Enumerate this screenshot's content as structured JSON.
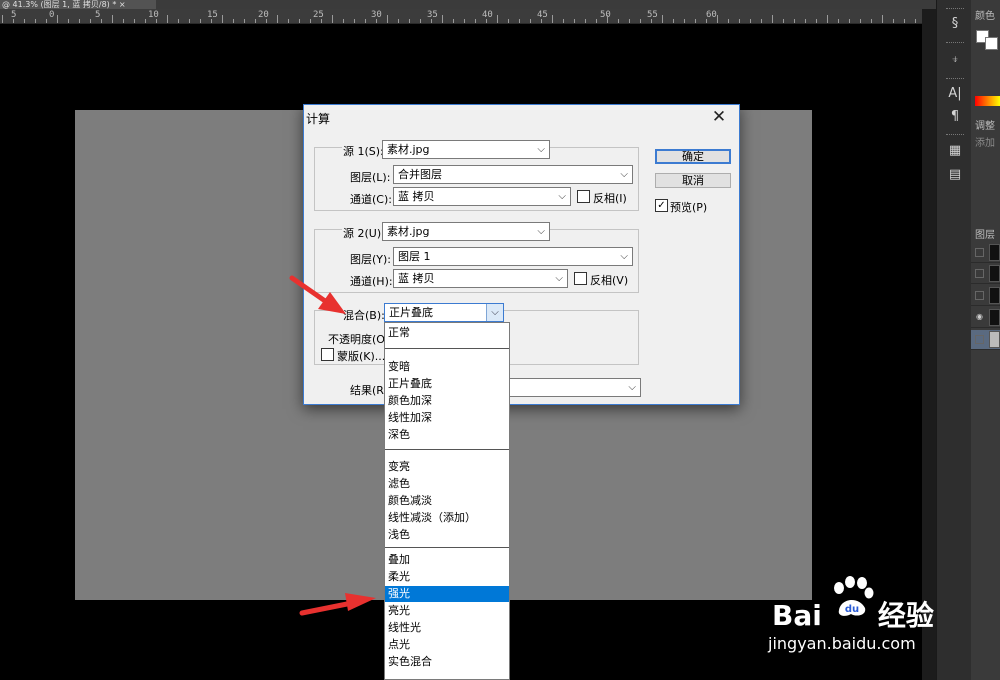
{
  "document": {
    "tab_title": "@ 41.3% (图层 1, 蓝 拷贝/8) *",
    "tab_close": "×"
  },
  "ruler": {
    "numbers": [
      "5",
      "0",
      "5",
      "10",
      "15",
      "20",
      "25",
      "30",
      "35",
      "40",
      "45",
      "50",
      "55",
      "60"
    ]
  },
  "tool_panel": {
    "icons": [
      "history-brush-icon",
      "clone-source-icon",
      "character-icon",
      "paragraph-icon",
      "properties-icon",
      "notes-icon"
    ],
    "glyphs": [
      "§",
      "⍖",
      "A|",
      "¶",
      "▦",
      "▤"
    ]
  },
  "side_panel": {
    "color_tab": "颜色",
    "adjust_tab": "调整",
    "adjust_add": "添加",
    "layers_tab": "图层"
  },
  "dialog": {
    "title": "计算",
    "close": "✕",
    "source1": {
      "label": "源 1(S):",
      "value": "素材.jpg",
      "layer_label": "图层(L):",
      "layer_value": "合并图层",
      "channel_label": "通道(C):",
      "channel_value": "蓝 拷贝",
      "invert_label": "反相(I)",
      "invert_checked": false
    },
    "source2": {
      "label": "源 2(U):",
      "value": "素材.jpg",
      "layer_label": "图层(Y):",
      "layer_value": "图层 1",
      "channel_label": "通道(H):",
      "channel_value": "蓝 拷贝",
      "invert_label": "反相(V)",
      "invert_checked": false
    },
    "blending": {
      "label": "混合(B):",
      "value": "正片叠底",
      "opacity_label": "不透明度(O",
      "mask_label": "蒙版(K)..."
    },
    "result_label": "结果(R",
    "ok_button": "确定",
    "cancel_button": "取消",
    "preview_label": "预览(P)",
    "preview_checked": true
  },
  "dropdown": {
    "groups": [
      [
        "正常"
      ],
      [
        "变暗",
        "正片叠底",
        "颜色加深",
        "线性加深",
        "深色"
      ],
      [
        "变亮",
        "滤色",
        "颜色减淡",
        "线性减淡（添加）",
        "浅色"
      ],
      [
        "叠加",
        "柔光",
        "强光",
        "亮光",
        "线性光",
        "点光",
        "实色混合"
      ]
    ],
    "selected": "强光",
    "items": [
      "正常",
      "变暗",
      "正片叠底",
      "颜色加深",
      "线性加深",
      "深色",
      "变亮",
      "滤色",
      "颜色减淡",
      "线性减淡（添加）",
      "浅色",
      "叠加",
      "柔光",
      "强光",
      "亮光",
      "线性光",
      "点光",
      "实色混合"
    ]
  },
  "watermark": {
    "brand": "Bai",
    "brand_suffix": "经验",
    "url": "jingyan.baidu.com"
  },
  "colors": {
    "accent": "#3c7bd1",
    "selection": "#0078d7",
    "annotation_arrow": "#e8312f"
  }
}
